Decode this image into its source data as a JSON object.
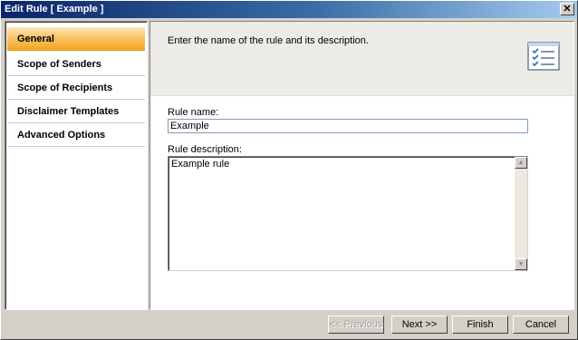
{
  "window": {
    "title": "Edit Rule [ Example ]",
    "close_glyph": "✕"
  },
  "sidebar": {
    "items": [
      {
        "label": "General",
        "active": true
      },
      {
        "label": "Scope of Senders",
        "active": false
      },
      {
        "label": "Scope of Recipients",
        "active": false
      },
      {
        "label": "Disclaimer Templates",
        "active": false
      },
      {
        "label": "Advanced Options",
        "active": false
      }
    ]
  },
  "main": {
    "instruction": "Enter the name of the rule and its description.",
    "header_icon": "checklist-icon",
    "rule_name_label": "Rule name:",
    "rule_name_value": "Example",
    "rule_description_label": "Rule description:",
    "rule_description_value": "Example rule"
  },
  "buttons": {
    "previous": "<< Previous",
    "next": "Next >>",
    "finish": "Finish",
    "cancel": "Cancel"
  },
  "colors": {
    "titlebar_start": "#0a246a",
    "titlebar_end": "#a6caf0",
    "active_item": "#f9c060",
    "dialog_bg": "#d4d0c8"
  }
}
